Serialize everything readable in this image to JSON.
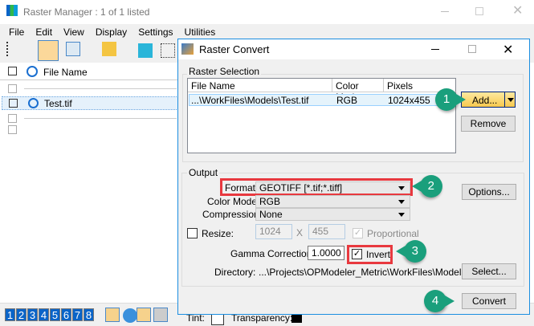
{
  "main_window": {
    "title": "Raster Manager : 1 of 1 listed",
    "menu": [
      "File",
      "Edit",
      "View",
      "Display",
      "Settings",
      "Utilities"
    ],
    "list_header": "File Name",
    "rows": [
      "Test.tif"
    ],
    "view_numbers": [
      "1",
      "2",
      "3",
      "4",
      "5",
      "6",
      "7",
      "8"
    ],
    "tint_label": "Tint:",
    "transparency_label": "Transparency:"
  },
  "dialog": {
    "title": "Raster Convert",
    "raster_selection": {
      "label": "Raster Selection",
      "columns": [
        "File Name",
        "Color Mode",
        "Pixels"
      ],
      "rows": [
        {
          "file": "...\\WorkFiles\\Models\\Test.tif",
          "color_mode": "RGB",
          "pixels": "1024x455"
        }
      ],
      "add_label": "Add...",
      "remove_label": "Remove"
    },
    "output": {
      "label": "Output",
      "format_label": "Format",
      "format_value": "GEOTIFF [*.tif;*.tiff]",
      "color_mode_label": "Color Mode",
      "color_mode_value": "RGB",
      "compression_label": "Compression",
      "compression_value": "None",
      "resize_label": "Resize:",
      "resize_checked": false,
      "width": "1024",
      "x_label": "X",
      "height": "455",
      "proportional_label": "Proportional",
      "proportional_checked": true,
      "gamma_label": "Gamma Correction:",
      "gamma_value": "1.0000",
      "invert_label": "Invert",
      "invert_checked": true,
      "directory_label": "Directory:",
      "directory_value": "...\\Projects\\OPModeler_Metric\\WorkFiles\\Models\\",
      "options_label": "Options...",
      "select_label": "Select...",
      "convert_label": "Convert"
    }
  },
  "callouts": [
    "1",
    "2",
    "3",
    "4"
  ],
  "colors": {
    "accent": "#1a9f7c",
    "highlight": "#e8393f",
    "dialog_border": "#1b8ee0"
  }
}
